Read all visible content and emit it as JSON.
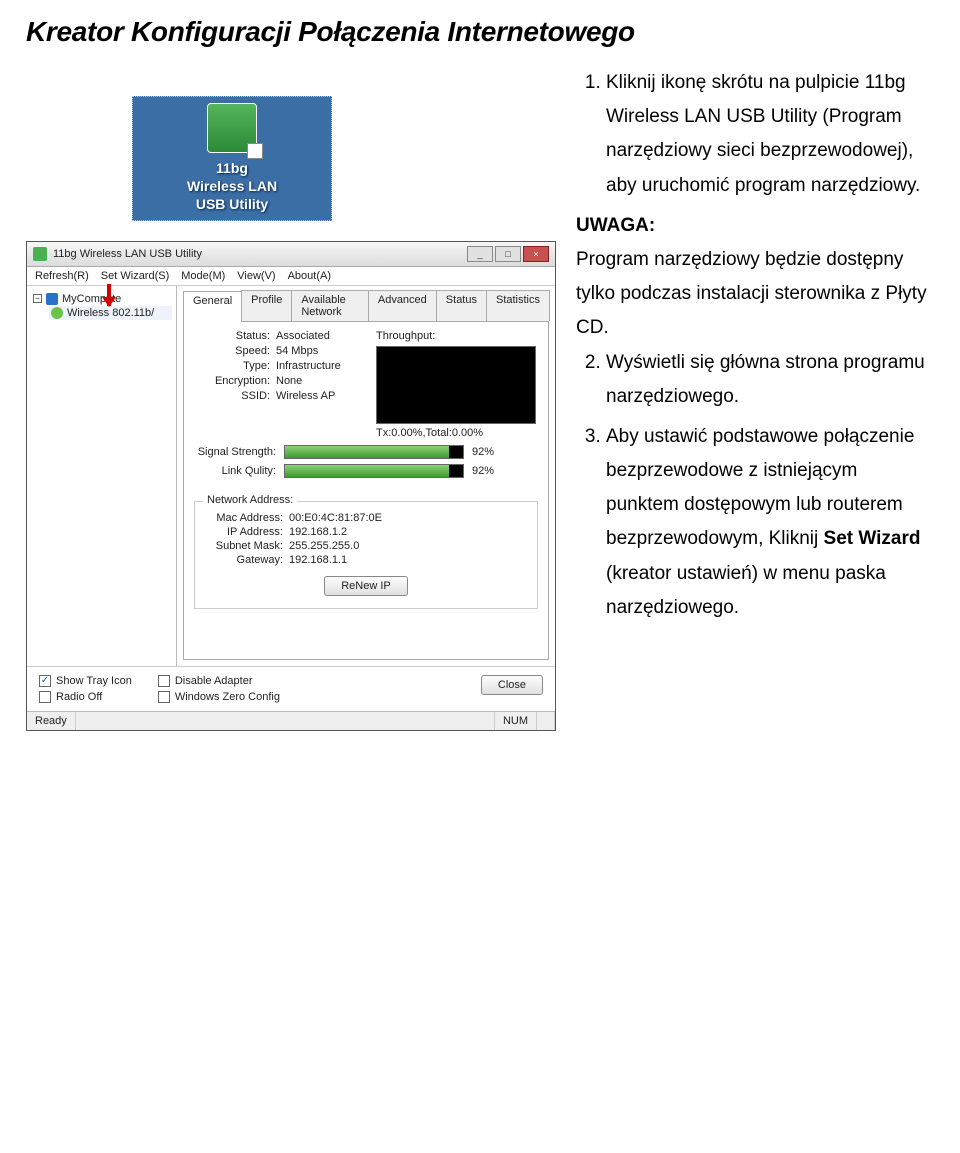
{
  "page_title": "Kreator Konfiguracji Połączenia Internetowego",
  "desktop_icon": {
    "line1": "11bg",
    "line2": "Wireless LAN",
    "line3": "USB Utility"
  },
  "steps": {
    "s1": "Kliknij ikonę skrótu na pulpicie 11bg Wireless LAN USB Utility (Program narzędziowy sieci bezprzewodowej), aby uruchomić program narzędziowy.",
    "uwaga_label": "UWAGA:",
    "uwaga_text": "Program narzędziowy będzie dostępny tylko podczas instalacji sterownika z Płyty CD.",
    "s2": "Wyświetli się główna strona programu narzędziowego.",
    "s3_pre": "Aby ustawić podstawowe połączenie bezprzewodowe z istniejącym punktem dostępowym lub routerem bezprzewodowym, Kliknij ",
    "s3_bold": "Set Wizard",
    "s3_post": " (kreator ustawień) w menu paska narzędziowego."
  },
  "util": {
    "title": "11bg Wireless LAN USB Utility",
    "win_minimize": "_",
    "win_maximize": "□",
    "win_close": "×",
    "menu": {
      "refresh": "Refresh(R)",
      "set_wizard": "Set Wizard(S)",
      "mode": "Mode(M)",
      "view": "View(V)",
      "about": "About(A)"
    },
    "tree": {
      "root": "MyCompute",
      "child": "Wireless 802.11b/"
    },
    "tabs": {
      "general": "General",
      "profile": "Profile",
      "available": "Available Network",
      "advanced": "Advanced",
      "status": "Status",
      "statistics": "Statistics"
    },
    "status": {
      "status_k": "Status:",
      "status_v": "Associated",
      "speed_k": "Speed:",
      "speed_v": "54 Mbps",
      "type_k": "Type:",
      "type_v": "Infrastructure",
      "enc_k": "Encryption:",
      "enc_v": "None",
      "ssid_k": "SSID:",
      "ssid_v": "Wireless AP",
      "throughput": "Throughput:",
      "graph_caption": "Tx:0.00%,Total:0.00%",
      "sig_k": "Signal Strength:",
      "sig_pct": "92%",
      "link_k": "Link Qulity:",
      "link_pct": "92%"
    },
    "netaddr": {
      "box_title": "Network Address:",
      "mac_k": "Mac Address:",
      "mac_v": "00:E0:4C:81:87:0E",
      "ip_k": "IP Address:",
      "ip_v": "192.168.1.2",
      "mask_k": "Subnet Mask:",
      "mask_v": "255.255.255.0",
      "gw_k": "Gateway:",
      "gw_v": "192.168.1.1",
      "renew_btn": "ReNew IP"
    },
    "footer": {
      "tray": "Show Tray Icon",
      "radio": "Radio Off",
      "disable": "Disable Adapter",
      "zero": "Windows Zero Config",
      "close": "Close"
    },
    "statusbar": {
      "ready": "Ready",
      "num": "NUM"
    }
  }
}
